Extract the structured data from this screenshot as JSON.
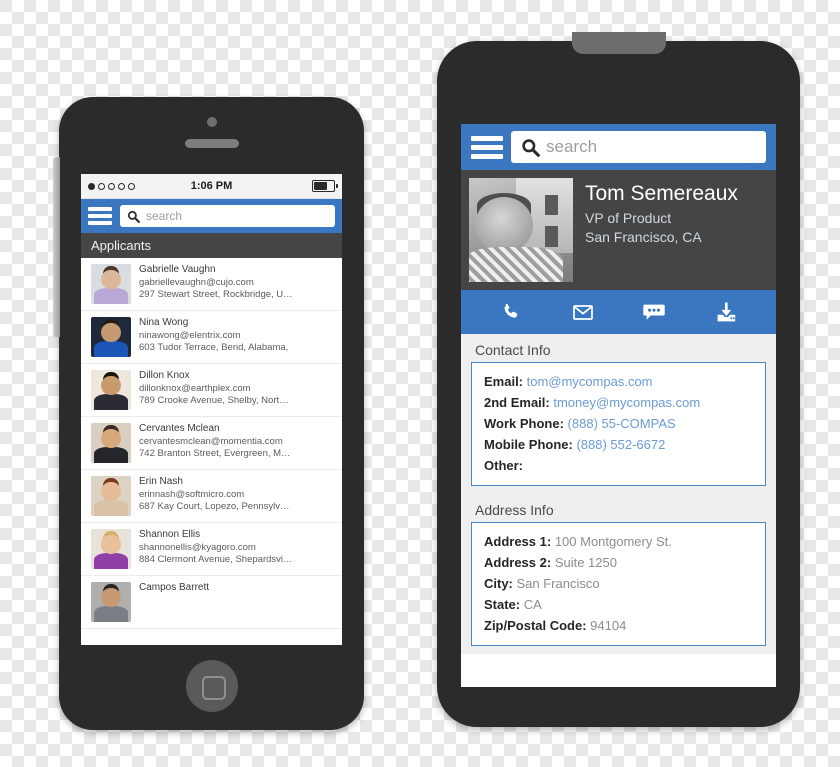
{
  "left_phone": {
    "status_bar": {
      "signal_dots_total": 5,
      "signal_dots_filled": 1,
      "time": "1:06 PM",
      "battery_icon": "battery-icon"
    },
    "nav": {
      "menu_icon": "hamburger-menu-icon",
      "search_icon": "search-icon",
      "search_value": "",
      "search_placeholder": "search"
    },
    "section_title": "Applicants",
    "applicants": [
      {
        "name": "Gabrielle Vaughn",
        "email": "gabriellevaughn@cujo.com",
        "address": "297 Stewart Street, Rockbridge, U…",
        "avatar": "avatar-gabrielle-vaughn",
        "skin": "#dcb79a",
        "hair": "#4a3a30",
        "shirt": "#b9a8d6",
        "bg": "#d9dde2"
      },
      {
        "name": "Nina Wong",
        "email": "ninawong@elentrix.com",
        "address": "603 Tudor Terrace, Bend, Alabama,",
        "avatar": "avatar-nina-wong",
        "skin": "#c69a72",
        "hair": "#241b16",
        "shirt": "#1b55b5",
        "bg": "#1e2a3a"
      },
      {
        "name": "Dillon Knox",
        "email": "dillonknox@earthplex.com",
        "address": "789 Crooke Avenue, Shelby, Nort…",
        "avatar": "avatar-dillon-knox",
        "skin": "#c99a6b",
        "hair": "#171310",
        "shirt": "#2b2b33",
        "bg": "#efe7dd"
      },
      {
        "name": "Cervantes Mclean",
        "email": "cervantesmclean@momentia.com",
        "address": "742 Branton Street, Evergreen, M…",
        "avatar": "avatar-cervantes-mclean",
        "skin": "#d8a87d",
        "hair": "#3a2b20",
        "shirt": "#23262b",
        "bg": "#d8cfc2"
      },
      {
        "name": "Erin Nash",
        "email": "erinnash@softmicro.com",
        "address": "687 Kay Court, Lopezo, Pennsylv…",
        "avatar": "avatar-erin-nash",
        "skin": "#e6bb97",
        "hair": "#7a3a1c",
        "shirt": "#d8c3a8",
        "bg": "#ddd3c4"
      },
      {
        "name": "Shannon Ellis",
        "email": "shannonellis@kyagoro.com",
        "address": "884 Clermont Avenue, Shepardsvi…",
        "avatar": "avatar-shannon-ellis",
        "skin": "#e8c09c",
        "hair": "#d6b06a",
        "shirt": "#8e3fa8",
        "bg": "#e8e3da"
      },
      {
        "name": "Campos Barrett",
        "email": "",
        "address": "",
        "avatar": "avatar-campos-barrett",
        "skin": "#c79a74",
        "hair": "#2a2522",
        "shirt": "#7a7f86",
        "bg": "#b0afae"
      }
    ]
  },
  "right_phone": {
    "nav": {
      "menu_icon": "hamburger-menu-icon",
      "search_icon": "search-icon",
      "search_value": "",
      "search_placeholder": "search"
    },
    "profile": {
      "photo_alt": "profile-photo-tom-semereaux",
      "name": "Tom Semereaux",
      "title": "VP of Product",
      "location": "San Francisco, CA"
    },
    "actions": [
      {
        "icon": "phone-icon",
        "label": "Call"
      },
      {
        "icon": "envelope-icon",
        "label": "Email"
      },
      {
        "icon": "chat-icon",
        "label": "Message"
      },
      {
        "icon": "download-icon",
        "label": "Save Contact"
      }
    ],
    "contact_info": {
      "title": "Contact Info",
      "fields": [
        {
          "label": "Email:",
          "value": "tom@mycompas.com"
        },
        {
          "label": "2nd Email:",
          "value": "tmoney@mycompas.com"
        },
        {
          "label": "Work Phone:",
          "value": "(888) 55-COMPAS"
        },
        {
          "label": "Mobile Phone:",
          "value": "(888) 552-6672"
        },
        {
          "label": "Other:",
          "value": ""
        }
      ]
    },
    "address_info": {
      "title": "Address Info",
      "fields": [
        {
          "label": "Address 1:",
          "value": "100 Montgomery St."
        },
        {
          "label": "Address 2:",
          "value": "Suite 1250"
        },
        {
          "label": "City:",
          "value": "San Francisco"
        },
        {
          "label": "State:",
          "value": "CA"
        },
        {
          "label": "Zip/Postal Code:",
          "value": "94104"
        }
      ]
    }
  },
  "colors": {
    "accent_blue": "#3b77c0",
    "panel_border_blue": "#4a85c7",
    "value_blue": "#6b9bd6",
    "dark_gray": "#454545",
    "phone_body": "#2b2b2b",
    "panel_bg": "#efefef"
  }
}
